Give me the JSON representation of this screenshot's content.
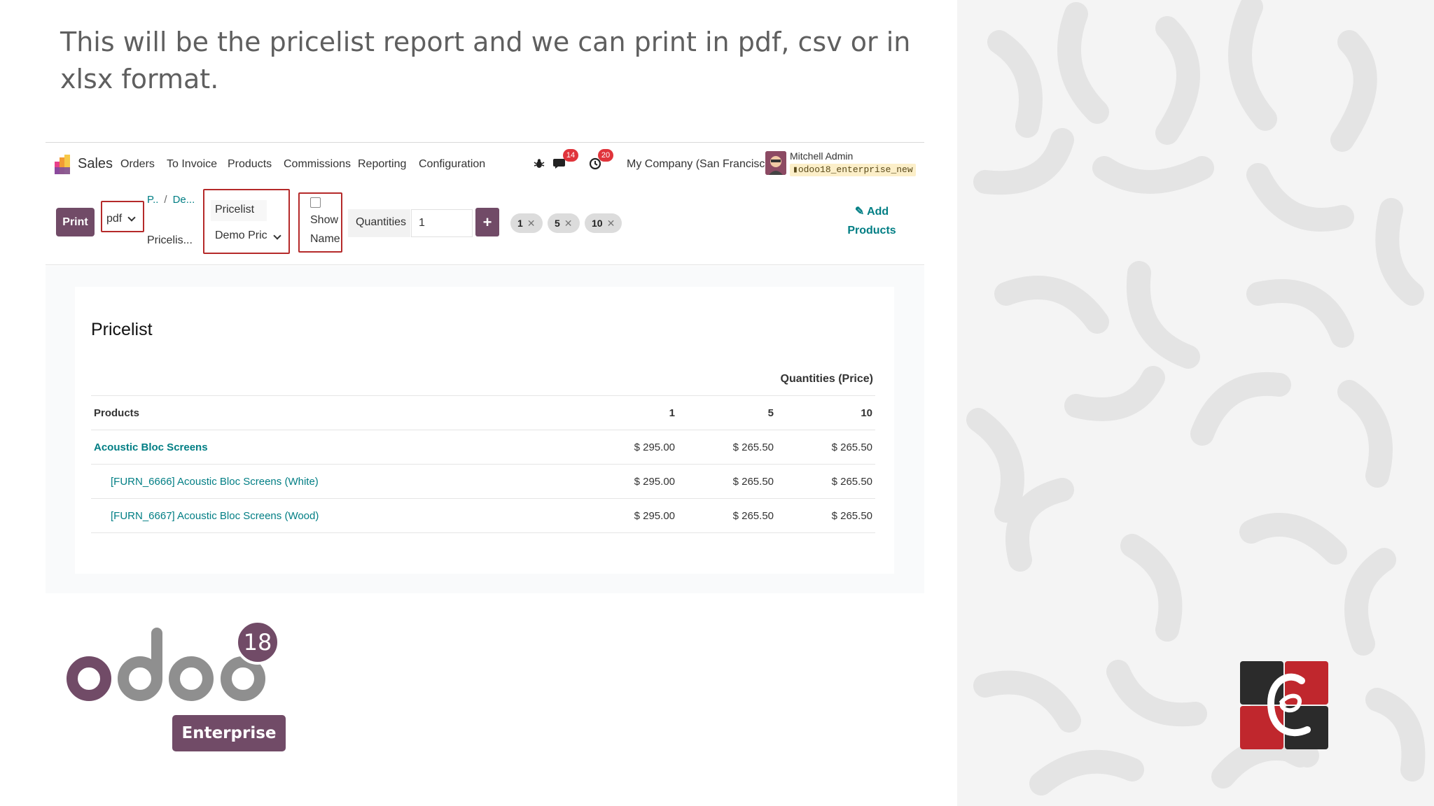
{
  "caption": "This will be the pricelist report and we can print in pdf, csv or in xlsx format.",
  "navbar": {
    "app_name": "Sales",
    "menu": [
      "Orders",
      "To Invoice",
      "Products",
      "Commissions",
      "Reporting",
      "Configuration"
    ],
    "chat_badge": "14",
    "activity_badge": "20",
    "company": "My Company (San Francisco)",
    "user_name": "Mitchell Admin",
    "db_name": "odoo18_enterprise_new"
  },
  "controls": {
    "print_label": "Print",
    "format_value": "pdf",
    "breadcrumb": [
      "P..",
      "De..."
    ],
    "current_page": "Pricelis...",
    "pricelist_label": "Pricelist",
    "pricelist_value": "Demo Pric",
    "show_name_label": "Show Name",
    "show_name_checked": false,
    "quantities_label": "Quantities",
    "quantity_input_value": "1",
    "add_qty_label": "+",
    "qty_chips": [
      "1",
      "5",
      "10"
    ],
    "add_products_label": "Add Products"
  },
  "report": {
    "title": "Pricelist",
    "quantities_header": "Quantities (Price)",
    "columns": [
      "Products",
      "1",
      "5",
      "10"
    ],
    "rows": [
      {
        "product": "Acoustic Bloc Screens",
        "prices": [
          "$ 295.00",
          "$ 265.50",
          "$ 265.50"
        ]
      },
      {
        "product": "[FURN_6666] Acoustic Bloc Screens (White)",
        "prices": [
          "$ 295.00",
          "$ 265.50",
          "$ 265.50"
        ]
      },
      {
        "product": "[FURN_6667] Acoustic Bloc Screens (Wood)",
        "prices": [
          "$ 295.00",
          "$ 265.50",
          "$ 265.50"
        ]
      }
    ]
  },
  "branding": {
    "odoo_version": "18",
    "odoo_edition": "Enterprise",
    "brand_color": "#714b67",
    "link_color": "#017e84"
  }
}
